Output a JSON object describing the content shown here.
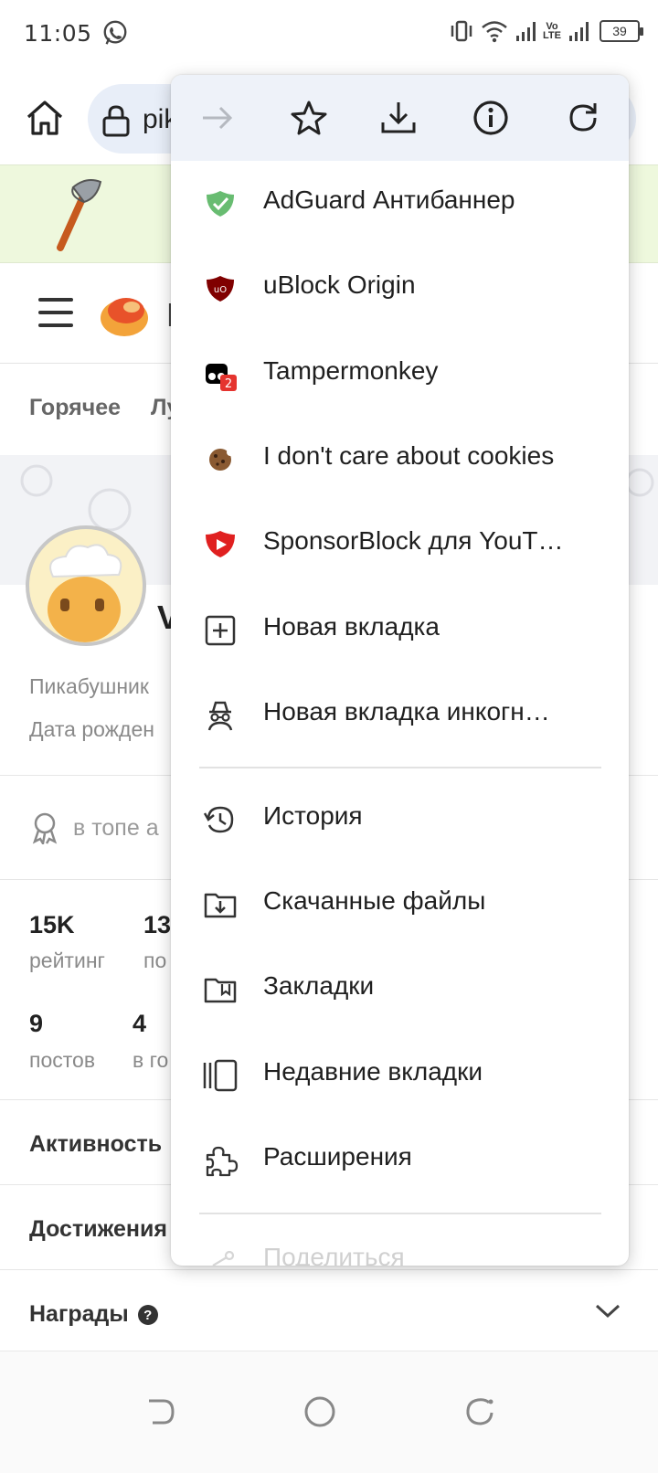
{
  "status": {
    "time": "11:05",
    "battery": "39",
    "volte": "Vo\nLTE"
  },
  "browser": {
    "url_fragment": "pik"
  },
  "site": {
    "logo_letter": "П",
    "tabs": [
      "Горячее",
      "Лу"
    ],
    "username_initial": "V",
    "profile_lines": [
      "Пикабушник",
      "Дата рожден"
    ],
    "top_text": "в топе а",
    "stats": [
      {
        "num": "15K",
        "label": "рейтинг"
      },
      {
        "num": "13",
        "label": "по"
      },
      {
        "num": "9",
        "label": "постов"
      },
      {
        "num": "4",
        "label": "в го"
      }
    ],
    "sections": [
      "Активность",
      "Достижения",
      "Награды"
    ]
  },
  "menu": {
    "top_icons": [
      "forward-icon",
      "bookmark-star-icon",
      "download-icon",
      "info-icon",
      "refresh-icon"
    ],
    "extensions": [
      {
        "label": "AdGuard Антибаннер",
        "icon": "adguard-icon",
        "color": "#68bc71"
      },
      {
        "label": "uBlock Origin",
        "icon": "ublock-icon",
        "color": "#800000"
      },
      {
        "label": "Tampermonkey",
        "icon": "tampermonkey-icon",
        "badge": "2"
      },
      {
        "label": "I don't care about cookies",
        "icon": "cookie-icon"
      },
      {
        "label": "SponsorBlock для YouT…",
        "icon": "sponsorblock-icon",
        "color": "#e02020"
      }
    ],
    "items_a": [
      {
        "label": "Новая вкладка",
        "icon": "new-tab-icon"
      },
      {
        "label": "Новая вкладка инкогн…",
        "icon": "incognito-icon"
      }
    ],
    "items_b": [
      {
        "label": "История",
        "icon": "history-icon"
      },
      {
        "label": "Скачанные файлы",
        "icon": "downloads-folder-icon"
      },
      {
        "label": "Закладки",
        "icon": "bookmarks-icon"
      },
      {
        "label": "Недавние вкладки",
        "icon": "recent-tabs-icon"
      },
      {
        "label": "Расширения",
        "icon": "extensions-icon"
      }
    ],
    "faded": "Поделиться"
  }
}
